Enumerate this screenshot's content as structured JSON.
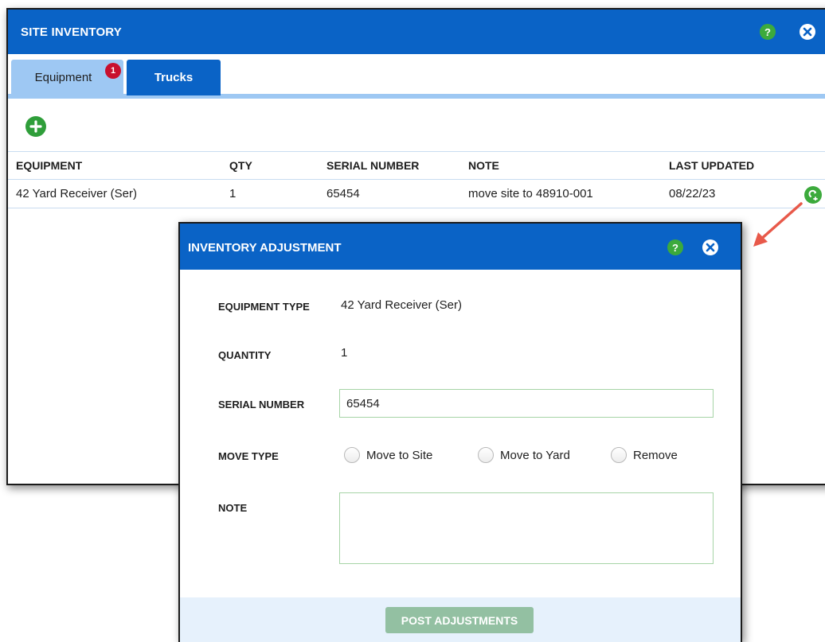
{
  "site_inventory": {
    "title": "SITE INVENTORY",
    "help_label": "?",
    "tabs": [
      {
        "label": "Equipment",
        "badge": "1",
        "active": true
      },
      {
        "label": "Trucks",
        "active": false
      }
    ],
    "columns": [
      "EQUIPMENT",
      "QTY",
      "SERIAL NUMBER",
      "NOTE",
      "LAST UPDATED"
    ],
    "rows": [
      {
        "equipment": "42 Yard Receiver (Ser)",
        "qty": "1",
        "serial": "65454",
        "note": "move site to 48910-001",
        "last_updated": "08/22/23"
      }
    ]
  },
  "modal": {
    "title": "INVENTORY ADJUSTMENT",
    "help_label": "?",
    "fields": {
      "equipment_type_label": "EQUIPMENT TYPE",
      "equipment_type_value": "42 Yard Receiver (Ser)",
      "quantity_label": "QUANTITY",
      "quantity_value": "1",
      "serial_number_label": "SERIAL NUMBER",
      "serial_number_value": "65454",
      "move_type_label": "MOVE TYPE",
      "move_options": [
        "Move to Site",
        "Move to Yard",
        "Remove"
      ],
      "note_label": "NOTE",
      "note_value": ""
    },
    "post_button": "POST ADJUSTMENTS"
  },
  "colors": {
    "header_blue": "#0a63c6",
    "tab_light_blue": "#9ec8f3",
    "help_green": "#3caa3c",
    "badge_red": "#c8102e",
    "post_button_green": "#93c0a2",
    "annotation_arrow": "#e8594a"
  },
  "icons": {
    "help": "question-circle-icon",
    "close": "close-circle-icon",
    "add": "plus-circle-icon",
    "row_action": "adjust-circle-icon"
  }
}
